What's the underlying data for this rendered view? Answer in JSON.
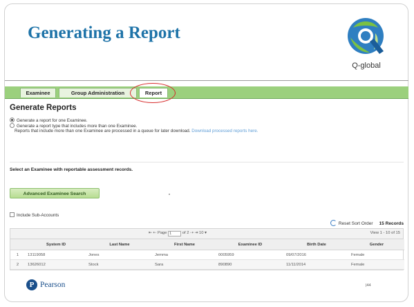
{
  "slide": {
    "title": "Generating a Report",
    "logo_text": "Q-global",
    "footer_brand": "Pearson",
    "footer_brand_mark": "P",
    "page_number": "|44"
  },
  "tabs": [
    {
      "label": "Examinee",
      "active": false
    },
    {
      "label": "Group Administration",
      "active": false
    },
    {
      "label": "Report",
      "active": true
    }
  ],
  "panel": {
    "heading": "Generate Reports",
    "options": [
      {
        "label": "Generate a report for one Examinee.",
        "selected": true
      },
      {
        "label": "Generate a report type that includes more than one Examinee.",
        "selected": false
      }
    ],
    "note": "Reports that include more than one Examinee are processed in a queue for later download.",
    "note_link": "Download processed reports here.",
    "select_label": "Select an Examinee with reportable assessment records.",
    "advanced_search_button": "Advanced Examinee Search",
    "include_sub_accounts": "Include Sub-Accounts",
    "reset_sort": "Reset Sort Order",
    "record_count": "15 Records"
  },
  "pager": {
    "first_prev": "⇤ ⇠",
    "page_label": "Page",
    "page_value": "1",
    "of_text": "of 2",
    "next_last": "⇢ ⇥",
    "per_page": "10 ▾",
    "view_text": "View 1 - 10 of 15"
  },
  "table": {
    "columns": [
      "",
      "System ID",
      "Last Name",
      "First Name",
      "Examinee ID",
      "Birth Date",
      "Gender"
    ],
    "rows": [
      [
        "1",
        "13119058",
        "Jones",
        "Jemma",
        "0005959",
        "09/07/2016",
        "Female"
      ],
      [
        "2",
        "13626012",
        "Stock",
        "Sara",
        "890890",
        "11/11/2014",
        "Female"
      ]
    ]
  },
  "colors": {
    "title": "#1e73a8",
    "tab_bar": "#9bd07d",
    "highlight_circle": "#d62a2a",
    "pearson_blue": "#1a4f8b"
  }
}
